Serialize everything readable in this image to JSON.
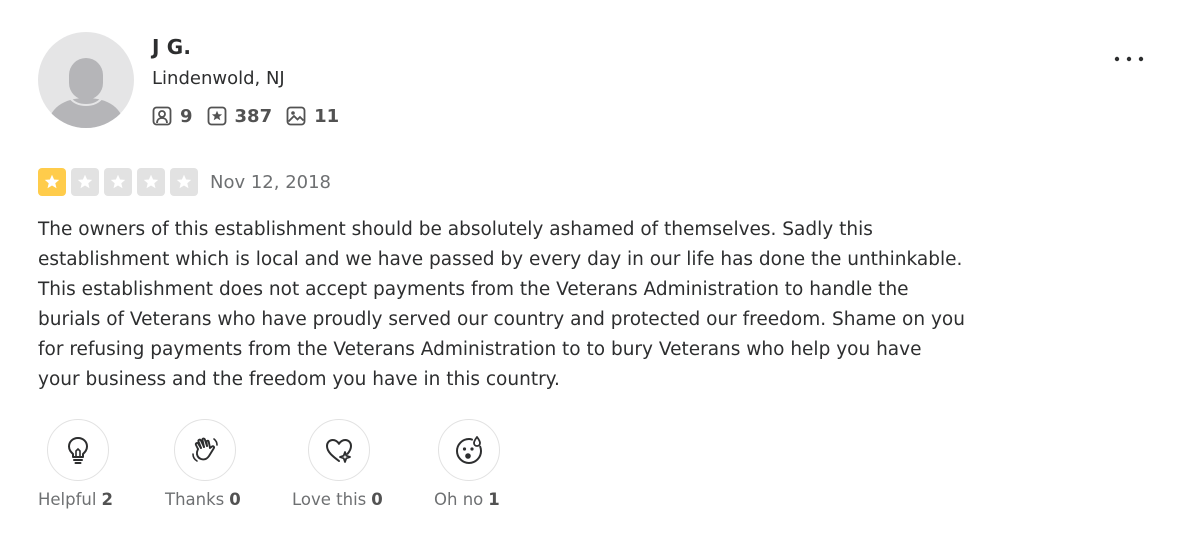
{
  "user": {
    "name": "J G.",
    "location": "Lindenwold, NJ",
    "stats": {
      "friends": "9",
      "reviews": "387",
      "photos": "11"
    },
    "avatar_icon": "default-user-avatar"
  },
  "menu": {
    "more_icon": "ellipsis-icon",
    "more_label": "···"
  },
  "review": {
    "rating": 1,
    "max_rating": 5,
    "star_color_filled": "#ffcc4b",
    "star_color_empty": "#e2e2e2",
    "date": "Nov 12, 2018",
    "text": "The owners of this establishment should be absolutely ashamed of themselves. Sadly this\nestablishment which is local and we have passed by every day in our life has done the unthinkable.\nThis establishment does not accept payments from the Veterans Administration to handle the\nburials of Veterans who have proudly served our country and protected our freedom. Shame on you\nfor refusing payments from the Veterans Administration to to bury Veterans who help you have\nyour business and the freedom you have in this country."
  },
  "reactions": {
    "helpful": {
      "label": "Helpful",
      "count": "2",
      "icon": "lightbulb-icon"
    },
    "thanks": {
      "label": "Thanks",
      "count": "0",
      "icon": "waving-hand-icon"
    },
    "love": {
      "label": "Love this",
      "count": "0",
      "icon": "heart-sparkle-icon"
    },
    "ohno": {
      "label": "Oh no",
      "count": "1",
      "icon": "surprised-face-icon"
    }
  }
}
